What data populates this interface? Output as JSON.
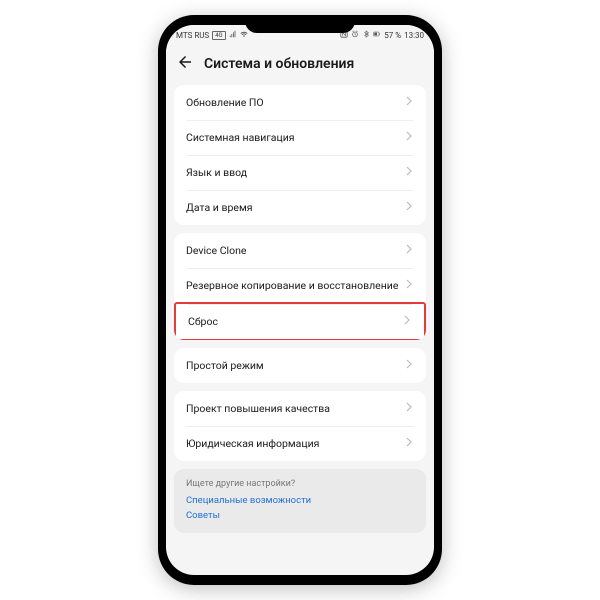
{
  "statusbar": {
    "carrier": "MTS RUS",
    "carrier_badge": "4G",
    "battery": "57 %",
    "time": "13:30"
  },
  "header": {
    "title": "Система и обновления"
  },
  "groups": [
    {
      "rows": [
        {
          "label": "Обновление ПО"
        },
        {
          "label": "Системная навигация"
        },
        {
          "label": "Язык и ввод"
        },
        {
          "label": "Дата и время"
        }
      ]
    },
    {
      "rows": [
        {
          "label": "Device Clone"
        },
        {
          "label": "Резервное копирование и восстановление"
        },
        {
          "label": "Сброс",
          "highlight": true
        }
      ]
    },
    {
      "rows": [
        {
          "label": "Простой режим"
        }
      ]
    },
    {
      "rows": [
        {
          "label": "Проект повышения качества"
        },
        {
          "label": "Юридическая информация"
        }
      ]
    }
  ],
  "tips": {
    "title": "Ищете другие настройки?",
    "links": [
      "Специальные возможности",
      "Советы"
    ]
  }
}
